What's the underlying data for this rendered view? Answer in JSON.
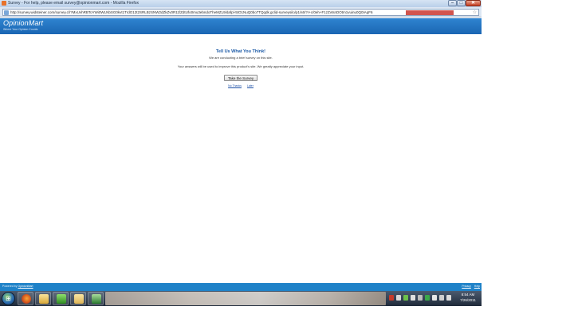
{
  "window": {
    "title": "Survey - For help, please email survey@opinionmart.com - Mozilla Firefox",
    "url": "http://survey.widsteiner.com/survey.cl/?MxUvhRBToYWi0WLNbSG0kvt1TrdO12t2SRLBzSNW2dZkZv0R11fZdtUfo0mu3ebndoTheMZL9/dafpl-5tO1NuQ0bo7TQqdk.gclid-surveysilo/p1/s6/?r+c/0eh+F1zZvtsnDOtm1vuinu0Q0IAqF6"
  },
  "site": {
    "brand": "OpinionMart",
    "tagline": "Where Your Opinion Counts"
  },
  "survey": {
    "heading": "Tell Us What You Think!",
    "line1": "We are conducting a brief survey on this site.",
    "line2": "Your answers will be used to improve this product's site. We greatly appreciate your input.",
    "button": "Take the Survey",
    "link_no_thanks": "No Thanks",
    "link_later": "Later"
  },
  "footer": {
    "powered_prefix": "Powered by ",
    "powered_link": "OpinionMart",
    "privacy": "Privacy",
    "help": "Help"
  },
  "taskbar": {
    "time": "8:54 AM",
    "date": "7/26/2011"
  },
  "icons": {
    "favicon": "firefox-icon",
    "start": "windows-start-orb-icon",
    "tray": [
      "flag-icon",
      "network-icon",
      "volume-icon",
      "shield-icon"
    ]
  }
}
